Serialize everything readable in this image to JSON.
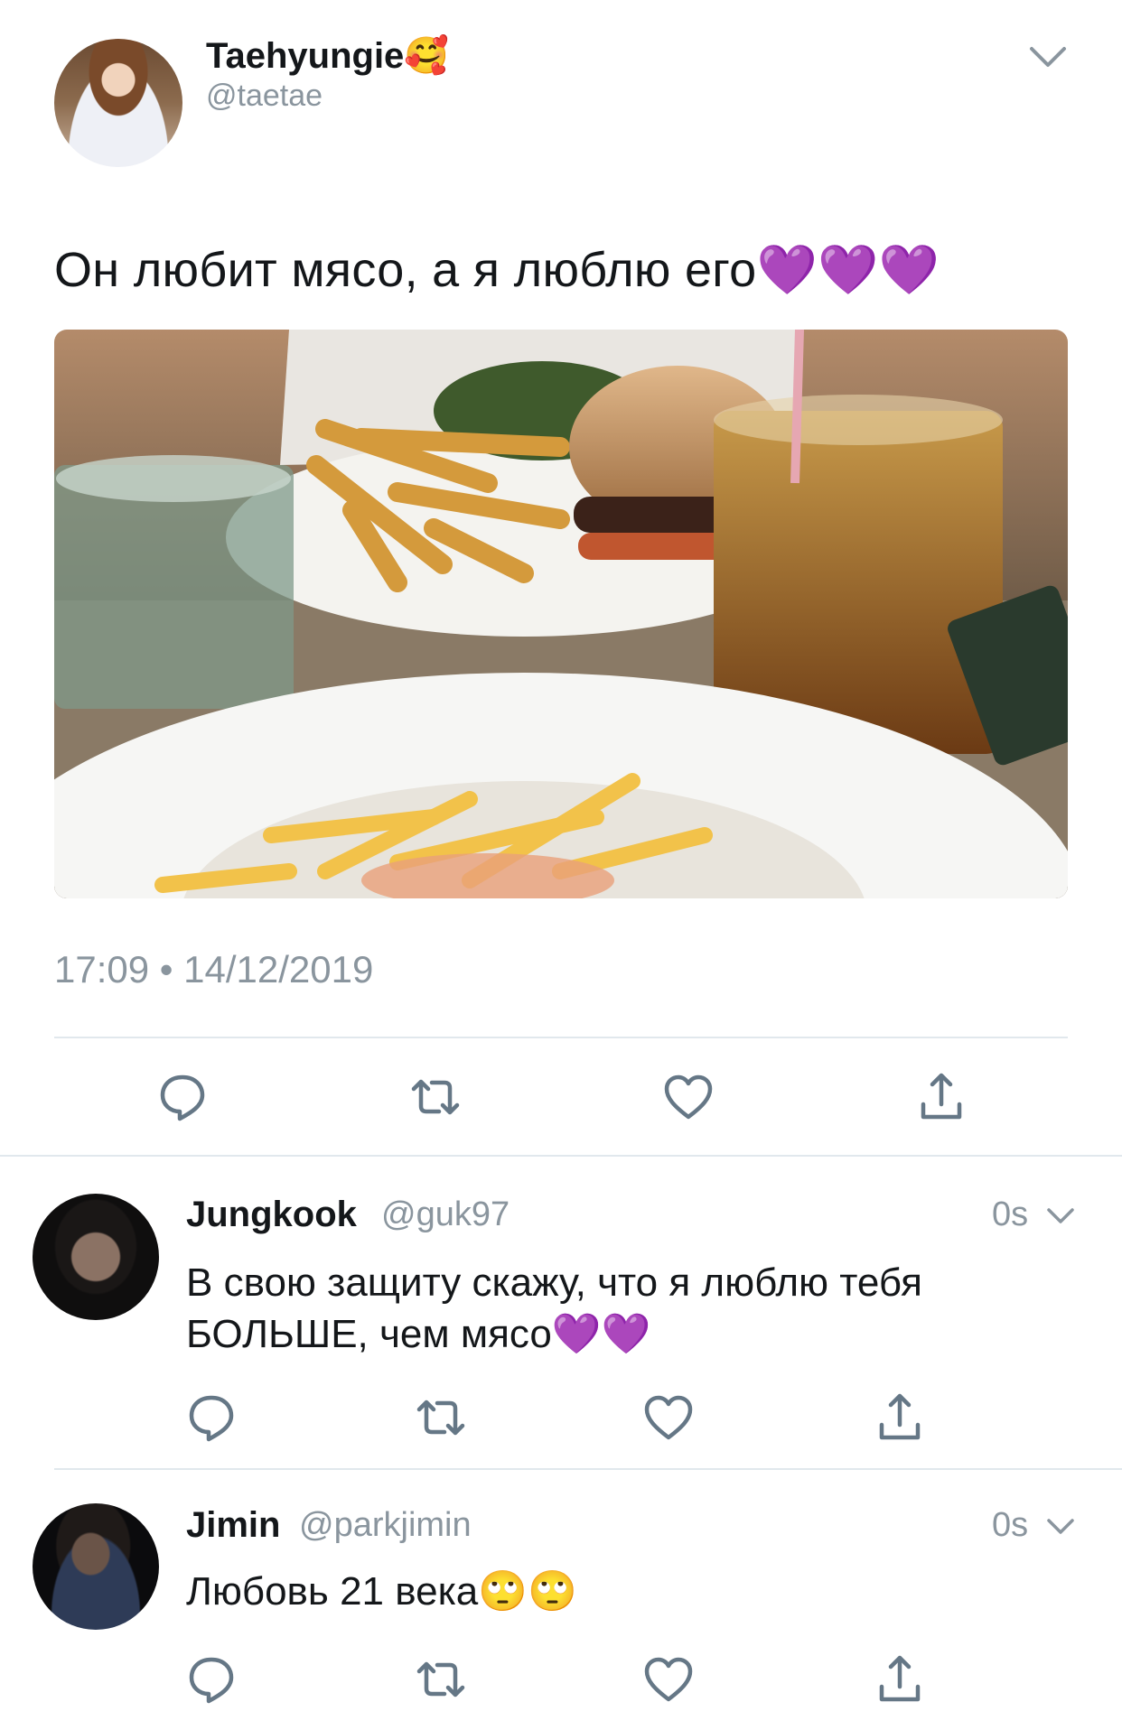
{
  "main_tweet": {
    "display_name": "Taehyungie🥰",
    "handle": "@taetae",
    "text": "Он любит мясо, а я люблю его💜💜💜",
    "timestamp": "17:09 • 14/12/2019",
    "photo_icon": "food-photo",
    "actions": [
      "reply-icon",
      "retweet-icon",
      "like-icon",
      "share-icon"
    ]
  },
  "replies": [
    {
      "display_name": "Jungkook",
      "handle": "@guk97",
      "time": "0s",
      "text_line1": "В свою защиту скажу, что я люблю тебя",
      "text_line2": "БОЛЬШЕ, чем мясо💜💜"
    },
    {
      "display_name": "Jimin",
      "handle": "@parkjimin",
      "time": "0s",
      "text_line1": "Любовь 21 века🙄🙄"
    }
  ],
  "colors": {
    "text": "#14171a",
    "secondary": "#8a959e",
    "divider": "#e1e8ed",
    "icon": "#657786"
  }
}
